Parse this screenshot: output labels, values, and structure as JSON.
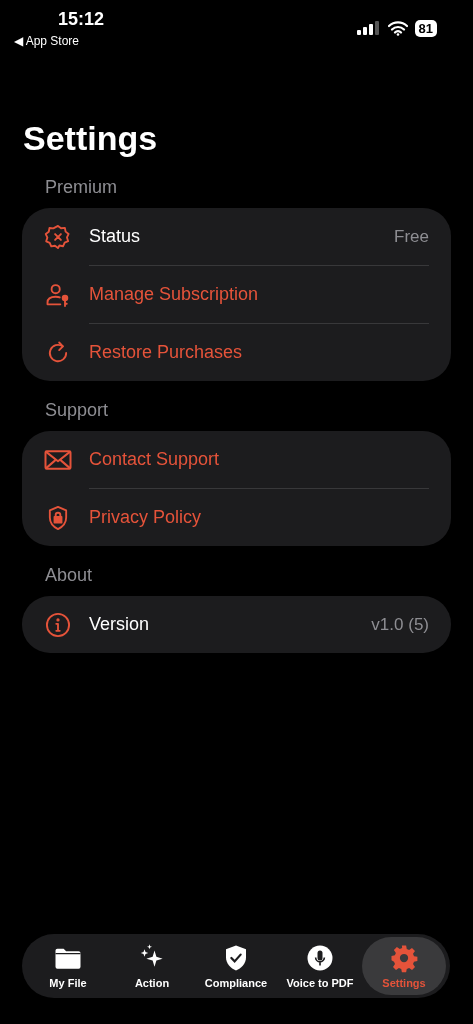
{
  "status_bar": {
    "time": "15:12",
    "back_label": "◀ App Store",
    "battery": "81"
  },
  "title": "Settings",
  "sections": [
    {
      "header": "Premium",
      "rows": [
        {
          "kind": "value",
          "label": "Status",
          "value": "Free"
        },
        {
          "kind": "link",
          "label": "Manage Subscription"
        },
        {
          "kind": "link",
          "label": "Restore Purchases"
        }
      ]
    },
    {
      "header": "Support",
      "rows": [
        {
          "kind": "link",
          "label": "Contact Support"
        },
        {
          "kind": "link",
          "label": "Privacy Policy"
        }
      ]
    },
    {
      "header": "About",
      "rows": [
        {
          "kind": "value",
          "label": "Version",
          "value": "v1.0 (5)"
        }
      ]
    }
  ],
  "tabs": [
    {
      "label": "My File",
      "selected": false
    },
    {
      "label": "Action",
      "selected": false
    },
    {
      "label": "Compliance",
      "selected": false
    },
    {
      "label": "Voice to PDF",
      "selected": false
    },
    {
      "label": "Settings",
      "selected": true
    }
  ]
}
